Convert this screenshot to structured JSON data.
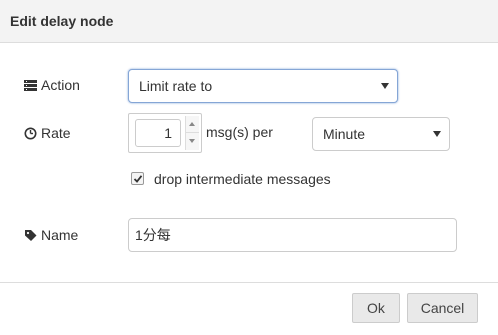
{
  "dialog": {
    "title": "Edit delay node"
  },
  "action": {
    "label": "Action",
    "icon": "list-icon",
    "selected": "Limit rate to"
  },
  "rate": {
    "label": "Rate",
    "icon": "clock-icon",
    "value": "1",
    "per_text": "msg(s) per",
    "unit_selected": "Minute"
  },
  "drop": {
    "checked": true,
    "label": "drop intermediate messages"
  },
  "name": {
    "label": "Name",
    "icon": "tag-icon",
    "value": "1分每"
  },
  "buttons": {
    "ok": "Ok",
    "cancel": "Cancel"
  }
}
